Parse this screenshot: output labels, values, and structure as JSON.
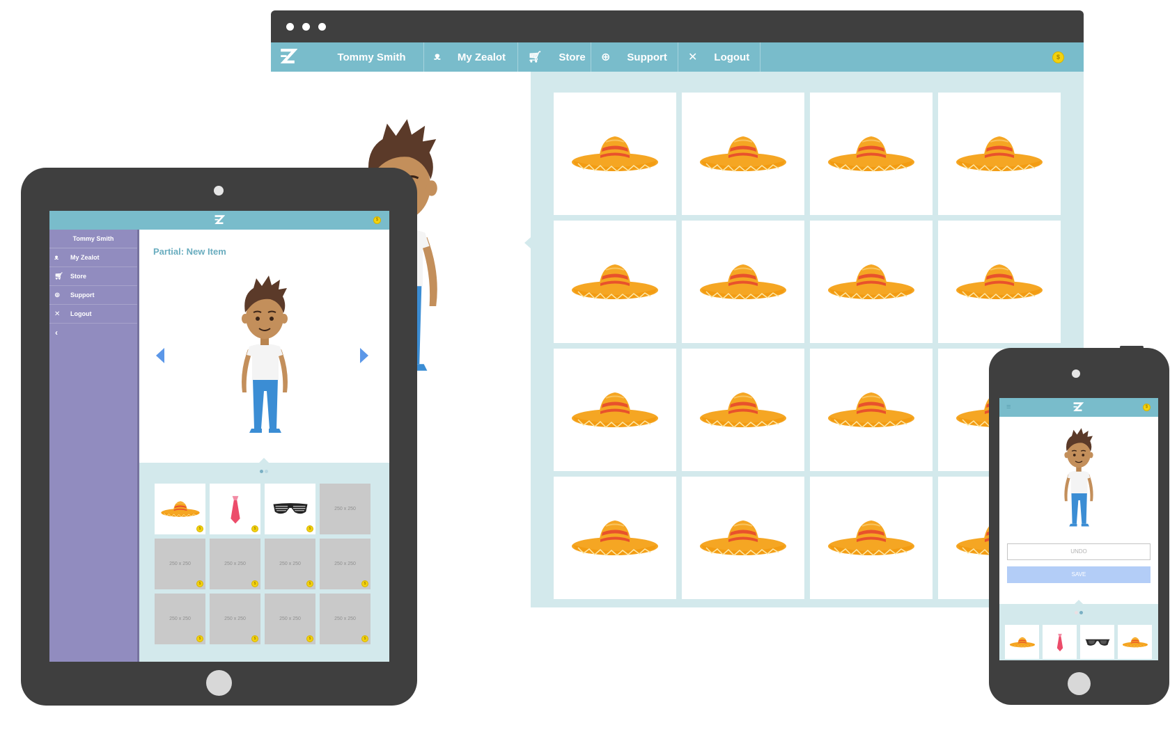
{
  "browser": {
    "nav": {
      "user_name": "Tommy Smith",
      "items": [
        {
          "label": "My Zealot",
          "icon": "mustache-icon"
        },
        {
          "label": "Store",
          "icon": "cart-icon"
        },
        {
          "label": "Support",
          "icon": "lifebuoy-icon"
        },
        {
          "label": "Logout",
          "icon": "close-icon"
        }
      ],
      "coin_symbol": "$"
    },
    "store_grid": {
      "item": "sombrero",
      "rows": 4,
      "columns": 4
    }
  },
  "tablet": {
    "sidebar": {
      "user_name": "Tommy Smith",
      "items": [
        {
          "label": "My Zealot",
          "icon": "mustache-icon"
        },
        {
          "label": "Store",
          "icon": "cart-icon"
        },
        {
          "label": "Support",
          "icon": "lifebuoy-icon"
        },
        {
          "label": "Logout",
          "icon": "close-icon"
        }
      ],
      "back_icon": "chevron-left-icon"
    },
    "main": {
      "title": "Partial: New Item"
    },
    "item_grid": {
      "items": [
        {
          "kind": "sombrero"
        },
        {
          "kind": "tie"
        },
        {
          "kind": "shutter-shades"
        },
        {
          "kind": "placeholder",
          "label": "250 x 250"
        },
        {
          "kind": "placeholder",
          "label": "250 x 250"
        },
        {
          "kind": "placeholder",
          "label": "250 x 250"
        },
        {
          "kind": "placeholder",
          "label": "250 x 250"
        },
        {
          "kind": "placeholder",
          "label": "250 x 250"
        },
        {
          "kind": "placeholder",
          "label": "250 x 250"
        },
        {
          "kind": "placeholder",
          "label": "250 x 250"
        },
        {
          "kind": "placeholder",
          "label": "250 x 250"
        },
        {
          "kind": "placeholder",
          "label": "250 x 250"
        }
      ],
      "coin_symbol": "$"
    }
  },
  "phone": {
    "buttons": {
      "undo_label": "UNDO",
      "save_label": "SAVE"
    },
    "items": [
      "sombrero",
      "tie",
      "sunglasses",
      "sombrero"
    ]
  },
  "colors": {
    "nav_bar": "#79bccb",
    "panel_bg": "#d3e9ec",
    "sidebar": "#918cbf",
    "device_body": "#3f3f3f",
    "title_text": "#6aadbf",
    "arrow": "#5b97e8",
    "save_button": "#b3cdf7",
    "coin": "#f3d20f"
  }
}
